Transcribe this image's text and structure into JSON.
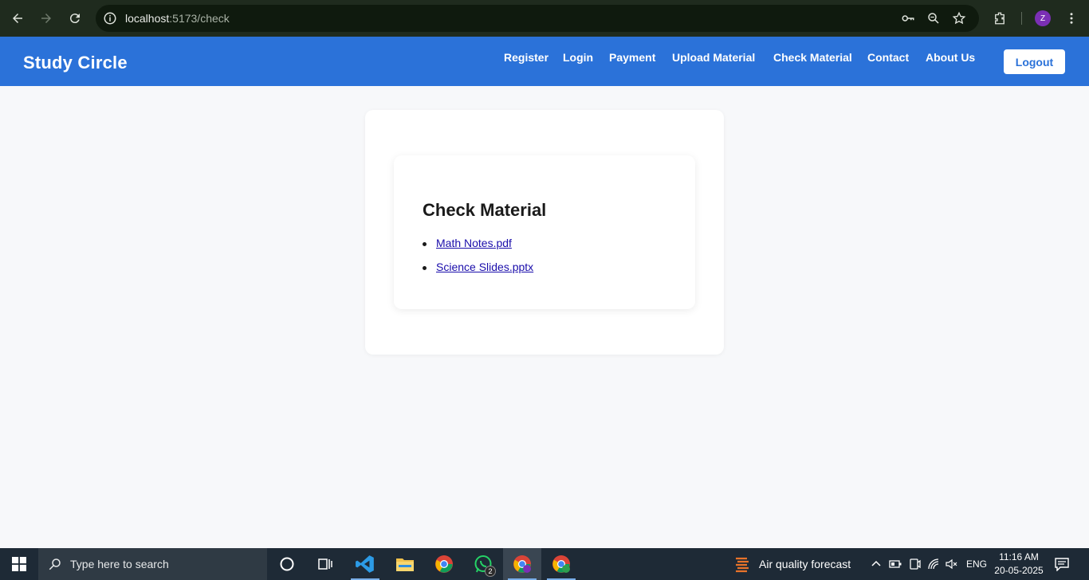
{
  "browser": {
    "url_host": "localhost",
    "url_path": ":5173/check",
    "profile_initial": "Z"
  },
  "navbar": {
    "brand": "Study Circle",
    "links": [
      {
        "label": "Register"
      },
      {
        "label": "Login"
      },
      {
        "label": "Payment"
      },
      {
        "label": "Upload Material"
      },
      {
        "label": "Check Material"
      },
      {
        "label": "Contact"
      },
      {
        "label": "About Us"
      }
    ],
    "logout_label": "Logout"
  },
  "main": {
    "title": "Check Material",
    "files": [
      {
        "name": "Math Notes.pdf"
      },
      {
        "name": "Science Slides.pptx"
      }
    ]
  },
  "taskbar": {
    "search_placeholder": "Type here to search",
    "whatsapp_badge": "2",
    "weather_text": "Air quality forecast",
    "language": "ENG",
    "time": "11:16 AM",
    "date": "20-05-2025"
  },
  "colors": {
    "navbar": "#2b72d9",
    "browser_bar": "#1f2b1e",
    "page_bg": "#f7f8fa",
    "link": "#1a0dab",
    "taskbar": "#1e2a36"
  }
}
